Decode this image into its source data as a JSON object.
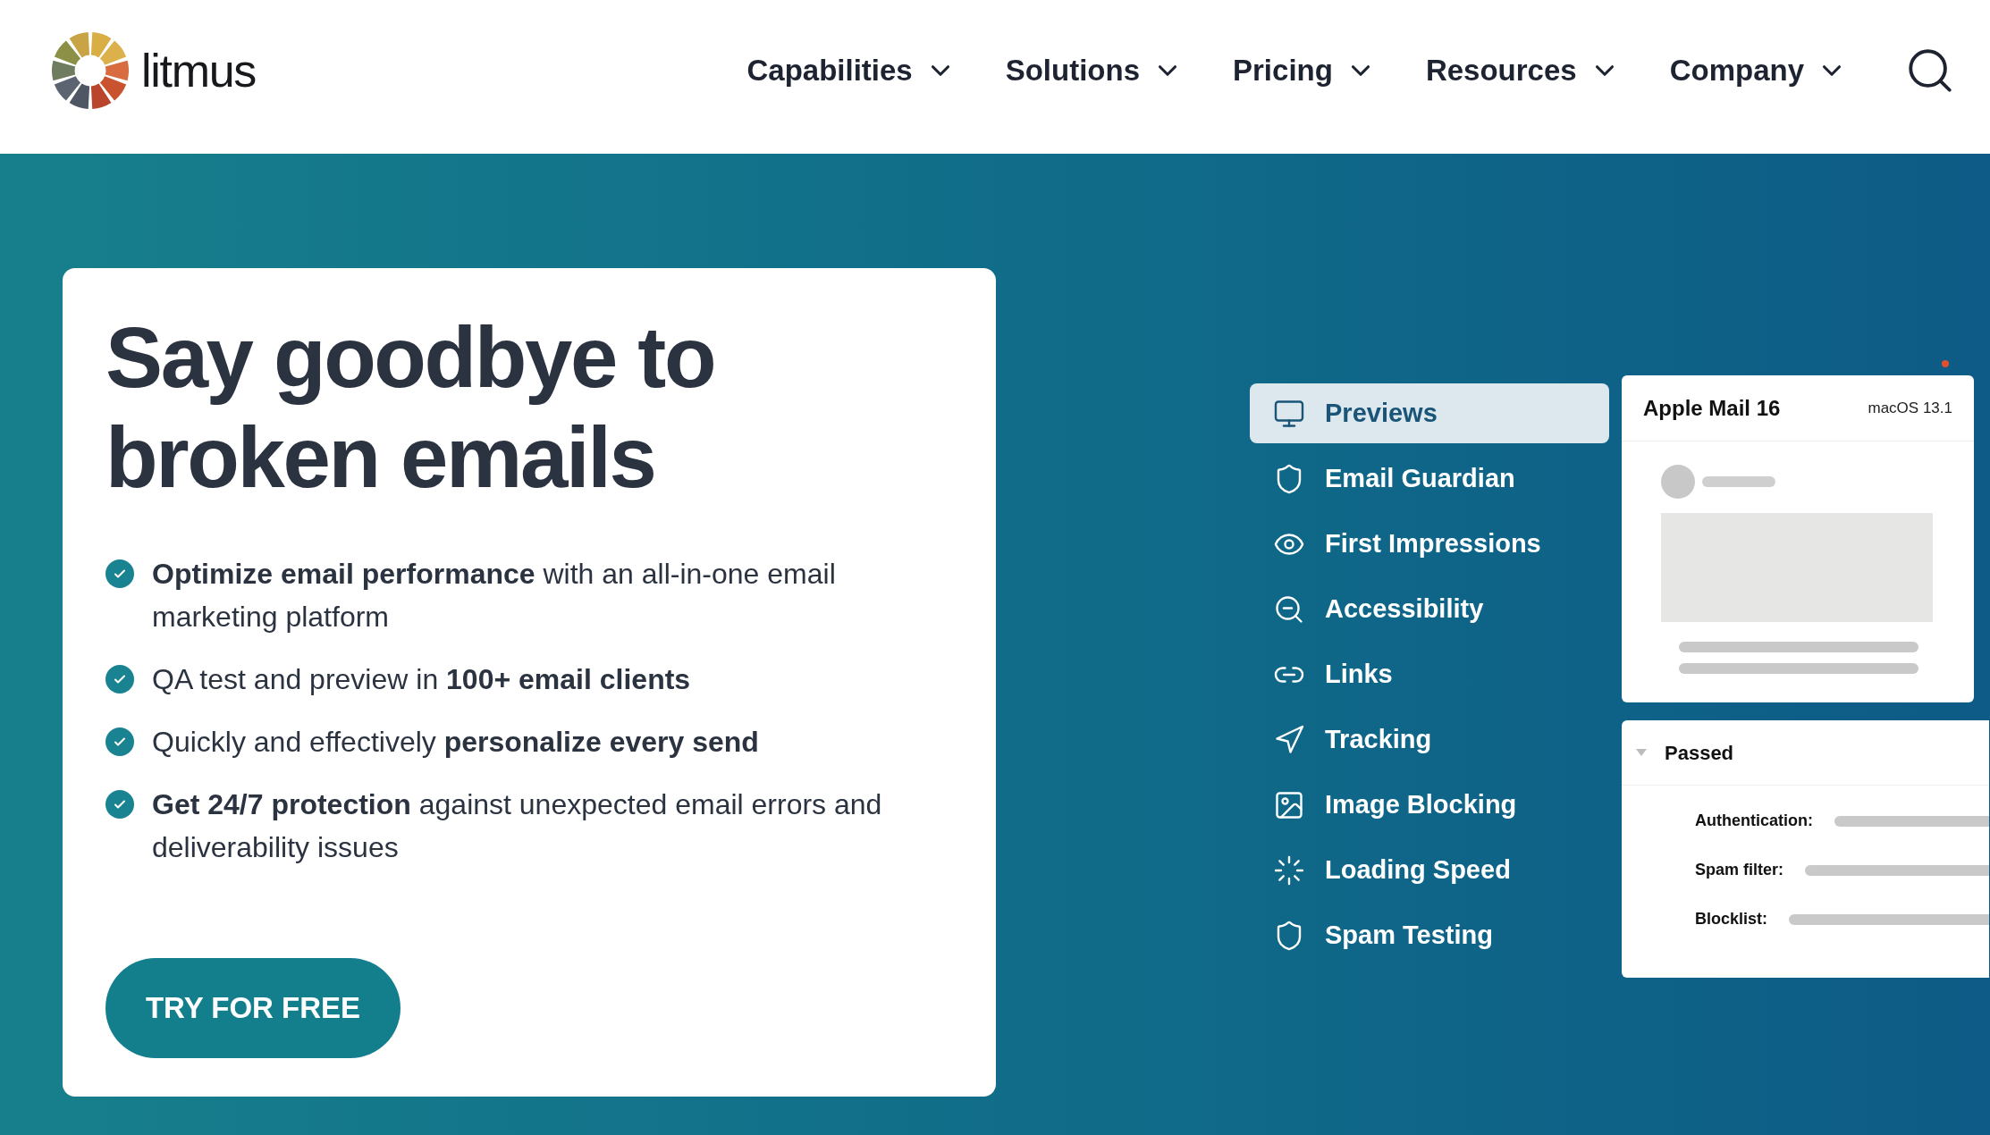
{
  "header": {
    "logo_text": "litmus",
    "nav": [
      {
        "label": "Capabilities"
      },
      {
        "label": "Solutions"
      },
      {
        "label": "Pricing"
      },
      {
        "label": "Resources"
      },
      {
        "label": "Company"
      }
    ]
  },
  "hero": {
    "title_lines": [
      "Say goodbye to",
      "broken emails"
    ],
    "bullets": [
      "**Optimize email performance** with an all-in-one email marketing platform",
      "QA test and preview in **100+ email clients**",
      "Quickly and effectively **personalize every send**",
      "**Get 24/7 protection** against unexpected email errors and deliverability issues"
    ],
    "cta": "TRY FOR FREE"
  },
  "features": [
    {
      "label": "Previews",
      "selected": true
    },
    {
      "label": "Email Guardian",
      "selected": false
    },
    {
      "label": "First Impressions",
      "selected": false
    },
    {
      "label": "Accessibility",
      "selected": false
    },
    {
      "label": "Links",
      "selected": false
    },
    {
      "label": "Tracking",
      "selected": false
    },
    {
      "label": "Image Blocking",
      "selected": false
    },
    {
      "label": "Loading Speed",
      "selected": false
    },
    {
      "label": "Spam Testing",
      "selected": false
    }
  ],
  "preview_card": {
    "client": "Apple Mail 16",
    "os": "macOS 13.1"
  },
  "checks_card": {
    "status": "Passed",
    "expanded": true,
    "rows": [
      "Authentication:",
      "Spam filter:",
      "Blocklist:"
    ]
  }
}
